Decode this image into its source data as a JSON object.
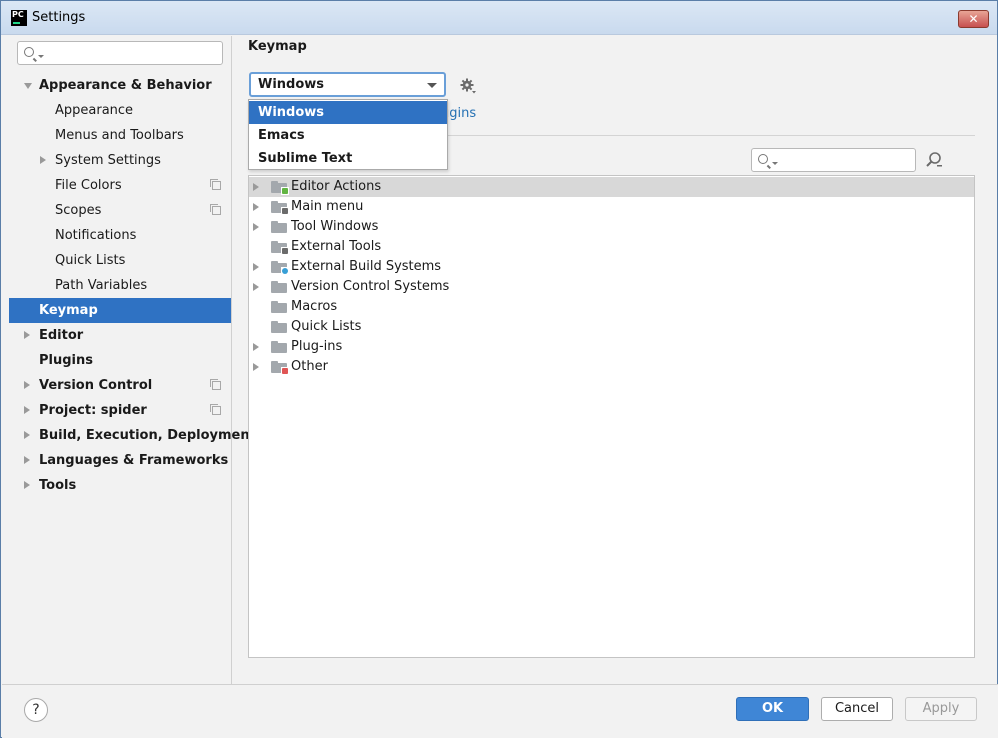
{
  "window": {
    "app_icon_text": "PC",
    "title": "Settings",
    "close_glyph": "✕"
  },
  "sidebar": {
    "search_placeholder": "",
    "items": [
      {
        "label": "Appearance & Behavior",
        "bold": true,
        "expanded": true
      },
      {
        "label": "Appearance"
      },
      {
        "label": "Menus and Toolbars"
      },
      {
        "label": "System Settings",
        "has_children": true
      },
      {
        "label": "File Colors",
        "project_icon": true
      },
      {
        "label": "Scopes",
        "project_icon": true
      },
      {
        "label": "Notifications"
      },
      {
        "label": "Quick Lists"
      },
      {
        "label": "Path Variables"
      },
      {
        "label": "Keymap",
        "bold": true,
        "selected": true
      },
      {
        "label": "Editor",
        "bold": true,
        "has_children": true
      },
      {
        "label": "Plugins",
        "bold": true
      },
      {
        "label": "Version Control",
        "bold": true,
        "has_children": true,
        "project_icon": true
      },
      {
        "label": "Project: spider",
        "bold": true,
        "has_children": true,
        "project_icon": true
      },
      {
        "label": "Build, Execution, Deployment",
        "bold": true,
        "has_children": true
      },
      {
        "label": "Languages & Frameworks",
        "bold": true,
        "has_children": true
      },
      {
        "label": "Tools",
        "bold": true,
        "has_children": true
      }
    ]
  },
  "main": {
    "title": "Keymap",
    "keymap_combo": {
      "selected": "Windows",
      "options": [
        "Windows",
        "Emacs",
        "Sublime Text"
      ]
    },
    "plugins_link_partial": "ugins",
    "action_search_placeholder": "",
    "actions": [
      {
        "label": "Editor Actions",
        "expandable": true,
        "highlighted": true,
        "icon": "editor-folder-icon"
      },
      {
        "label": "Main menu",
        "expandable": true,
        "icon": "menu-folder-icon"
      },
      {
        "label": "Tool Windows",
        "expandable": true,
        "icon": "folder-icon"
      },
      {
        "label": "External Tools",
        "expandable": false,
        "icon": "tools-folder-icon"
      },
      {
        "label": "External Build Systems",
        "expandable": true,
        "icon": "build-folder-icon"
      },
      {
        "label": "Version Control Systems",
        "expandable": true,
        "icon": "folder-icon"
      },
      {
        "label": "Macros",
        "expandable": false,
        "icon": "folder-icon"
      },
      {
        "label": "Quick Lists",
        "expandable": false,
        "icon": "folder-icon"
      },
      {
        "label": "Plug-ins",
        "expandable": true,
        "icon": "folder-icon"
      },
      {
        "label": "Other",
        "expandable": true,
        "icon": "other-folder-icon"
      }
    ]
  },
  "footer": {
    "help_label": "?",
    "ok_label": "OK",
    "cancel_label": "Cancel",
    "apply_label": "Apply"
  },
  "colors": {
    "selection": "#2f72c3",
    "link": "#2470b3",
    "ok_button": "#3f86d6"
  }
}
